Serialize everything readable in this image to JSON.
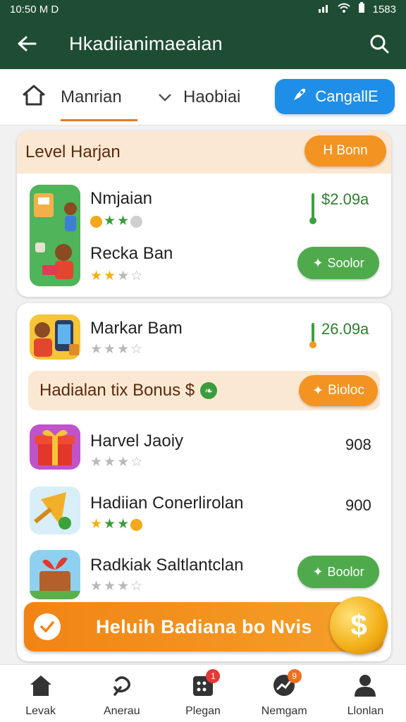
{
  "status_bar": {
    "time": "10:50 M D",
    "battery": "1583"
  },
  "app_bar": {
    "title": "Hkadiianimaeaian"
  },
  "tabs": [
    {
      "label": "Manrian"
    },
    {
      "label": "Haobiai"
    }
  ],
  "tab_cta": {
    "label": "CangallE"
  },
  "section1": {
    "title": "Level Harjan",
    "button": "H Bonn",
    "items": [
      {
        "name": "Nmjaian",
        "price": "$2.09a"
      },
      {
        "name": "Recka Ban",
        "button": "Soolor"
      }
    ]
  },
  "section2": {
    "items": [
      {
        "name": "Markar Bam",
        "price": "26.09a"
      }
    ],
    "banner": {
      "title": "Hadialan tix Bonus $",
      "button": "Bioloc"
    },
    "list": [
      {
        "name": "Harvel Jaoiy",
        "value": "908"
      },
      {
        "name": "Hadiian Conerlirolan",
        "value": "900"
      },
      {
        "name": "Radkiak Saltlantclan",
        "button": "Boolor"
      }
    ]
  },
  "promo": {
    "text": "Heluih Badiana bo Nvis"
  },
  "bottom_nav": [
    {
      "label": "Levak"
    },
    {
      "label": "Anerau",
      "badge": ""
    },
    {
      "label": "Plegan",
      "badge": "1"
    },
    {
      "label": "Nemgam",
      "badge": "9"
    },
    {
      "label": "Llonlan"
    }
  ],
  "colors": {
    "header": "#1f4d33",
    "accent_orange": "#f39322",
    "accent_green": "#4faa4c",
    "accent_blue": "#1f8ee8"
  }
}
